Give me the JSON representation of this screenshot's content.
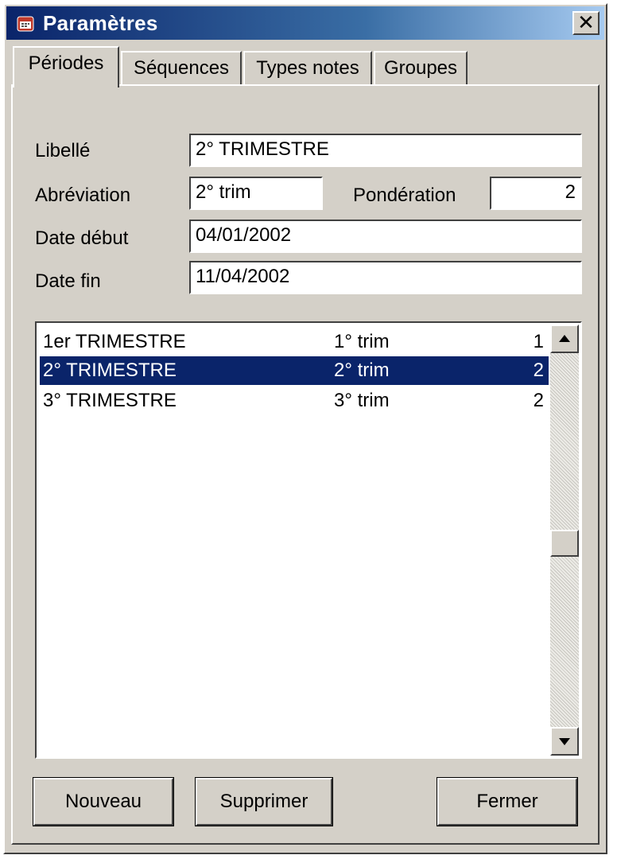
{
  "window": {
    "title": "Paramètres",
    "close_label": "✕"
  },
  "tabs": [
    {
      "label": "Périodes",
      "active": true
    },
    {
      "label": "Séquences",
      "active": false
    },
    {
      "label": "Types notes",
      "active": false
    },
    {
      "label": "Groupes",
      "active": false
    }
  ],
  "form": {
    "libelle_label": "Libellé",
    "libelle_value": "2° TRIMESTRE",
    "abreviation_label": "Abréviation",
    "abreviation_value": "2° trim",
    "ponderation_label": "Pondération",
    "ponderation_value": "2",
    "date_debut_label": "Date début",
    "date_debut_value": "04/01/2002",
    "date_fin_label": "Date fin",
    "date_fin_value": "11/04/2002"
  },
  "list": {
    "rows": [
      {
        "libelle": "1er TRIMESTRE",
        "abreviation": "1° trim",
        "ponderation": "1",
        "selected": false
      },
      {
        "libelle": "2° TRIMESTRE",
        "abreviation": "2° trim",
        "ponderation": "2",
        "selected": true
      },
      {
        "libelle": "3° TRIMESTRE",
        "abreviation": "3° trim",
        "ponderation": "2",
        "selected": false
      }
    ]
  },
  "buttons": {
    "nouveau": "Nouveau",
    "supprimer": "Supprimer",
    "fermer": "Fermer"
  },
  "colors": {
    "title_bar": "#0a246a",
    "selection": "#0a246a",
    "face": "#d4d0c8"
  }
}
